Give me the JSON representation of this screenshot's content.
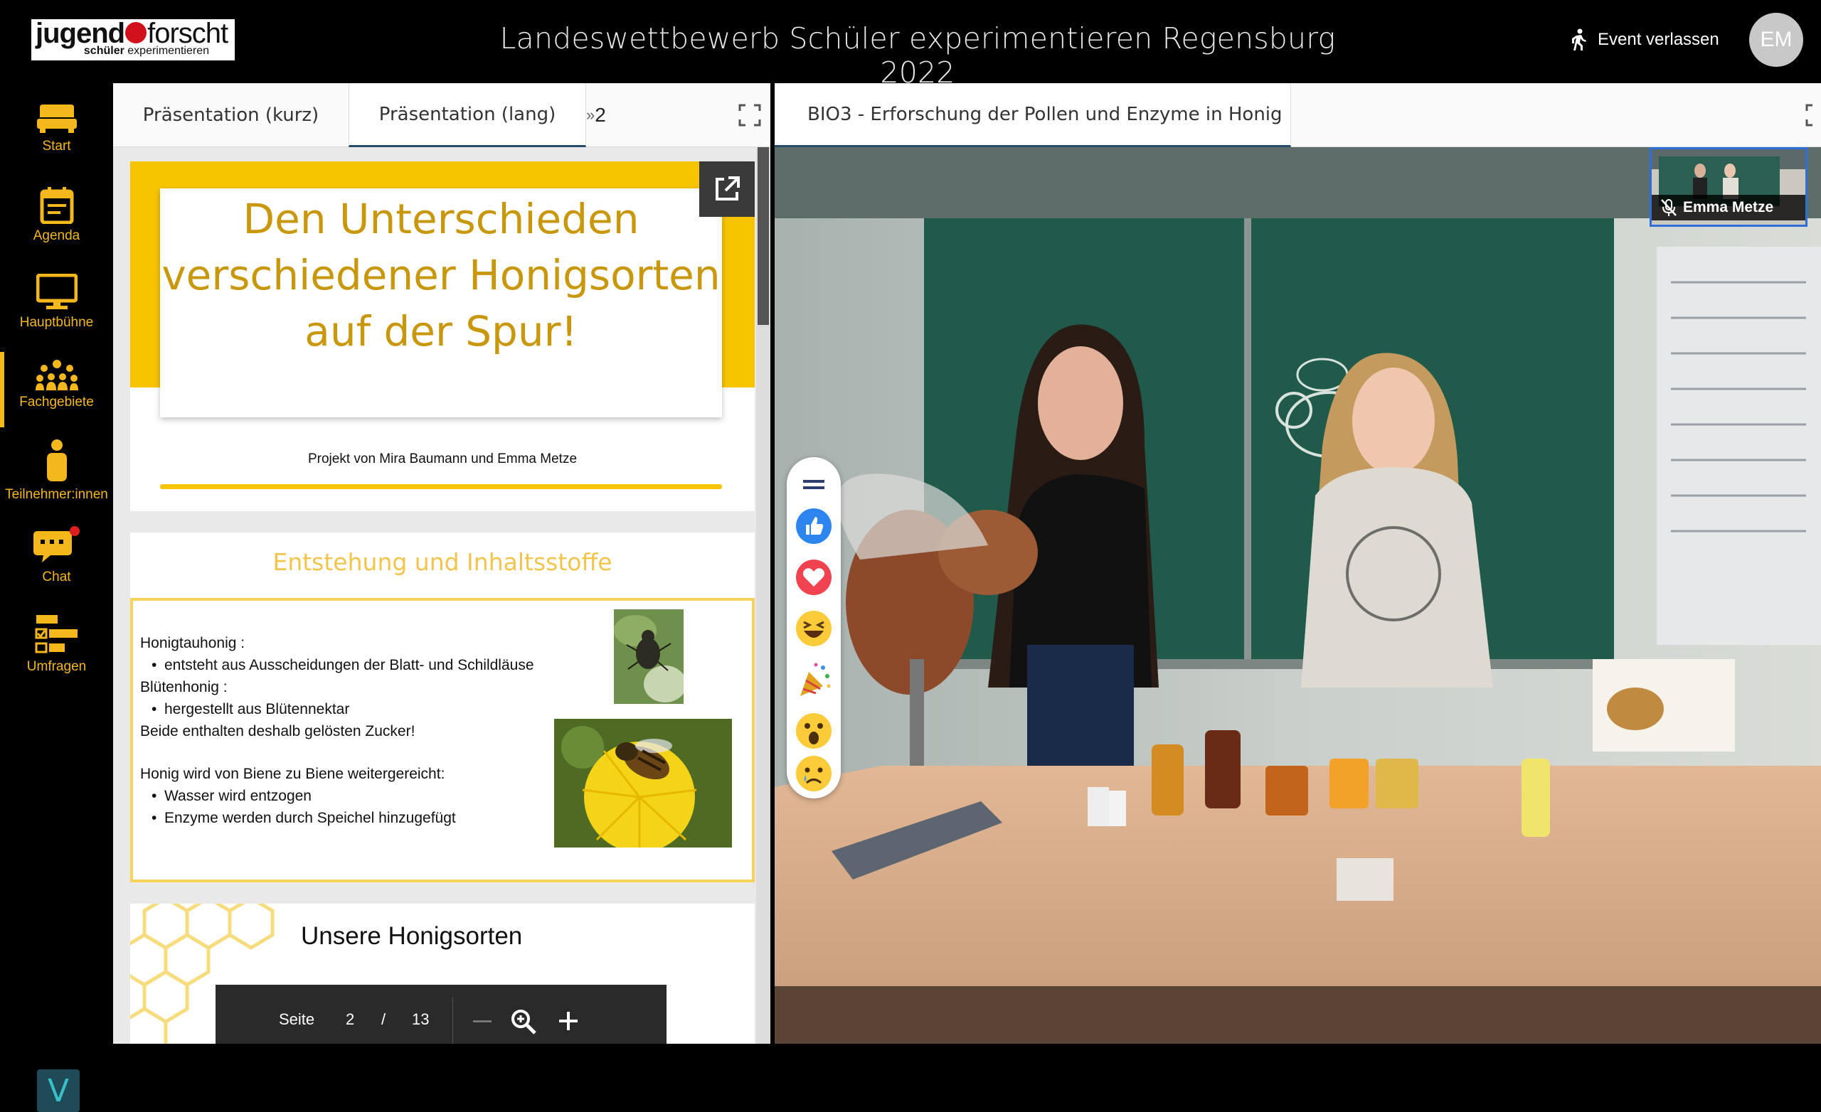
{
  "header": {
    "logo_brand_bold": "jugend",
    "logo_brand_thin": "forscht",
    "logo_sub_bold": "schüler",
    "logo_sub": " experimentieren",
    "event_title": "Landeswettbewerb Schüler experimentieren Regensburg 2022",
    "leave_label": "Event verlassen",
    "avatar_initials": "EM"
  },
  "sidebar": {
    "items": [
      {
        "label": "Start",
        "icon": "start-icon"
      },
      {
        "label": "Agenda",
        "icon": "agenda-icon"
      },
      {
        "label": "Hauptbühne",
        "icon": "monitor-icon"
      },
      {
        "label": "Fachgebiete",
        "icon": "group-icon"
      },
      {
        "label": "Teilnehmer:innen",
        "icon": "person-icon"
      },
      {
        "label": "Chat",
        "icon": "chat-icon"
      },
      {
        "label": "Umfragen",
        "icon": "poll-icon"
      }
    ],
    "active_item": "Fachgebiete",
    "footer_logo": "V"
  },
  "left_panel": {
    "tabs": [
      "Präsentation (kurz)",
      "Präsentation (lang)"
    ],
    "more_tabs_count": "2",
    "active_tab": "Präsentation (lang)"
  },
  "slides": {
    "s1": {
      "title": "Den Unterschieden verschiedener Honigsorten auf der Spur!",
      "subtitle": "Projekt von Mira Baumann und Emma Metze"
    },
    "s2": {
      "title": "Entstehung und Inhaltsstoffe",
      "lines": [
        "Honigtauhonig :",
        "entsteht aus Ausscheidungen der Blatt- und Schildläuse",
        "Blütenhonig :",
        "hergestellt aus Blütennektar",
        "Beide enthalten deshalb gelösten Zucker!",
        "Honig wird von Biene zu Biene weitergereicht:",
        "Wasser wird entzogen",
        "Enzyme werden durch Speichel hinzugefügt"
      ]
    },
    "s3": {
      "title": "Unsere Honigsorten"
    }
  },
  "pager": {
    "label": "Seite",
    "current": "2",
    "separator": "/",
    "total": "13"
  },
  "right_panel": {
    "tab_title": "BIO3 - Erforschung der Pollen und Enzyme in Honig",
    "pip_name": "Emma Metze"
  },
  "reactions": [
    "menu-icon",
    "thumbs-up-icon",
    "heart-icon",
    "laugh-icon",
    "party-icon",
    "surprised-icon",
    "sad-icon"
  ],
  "colors": {
    "accent": "#f5b81c",
    "slide_yellow": "#f7c500",
    "slide_title": "#c8970c",
    "tab_underline": "#274c6b",
    "pip_border": "#2f6fd8"
  }
}
